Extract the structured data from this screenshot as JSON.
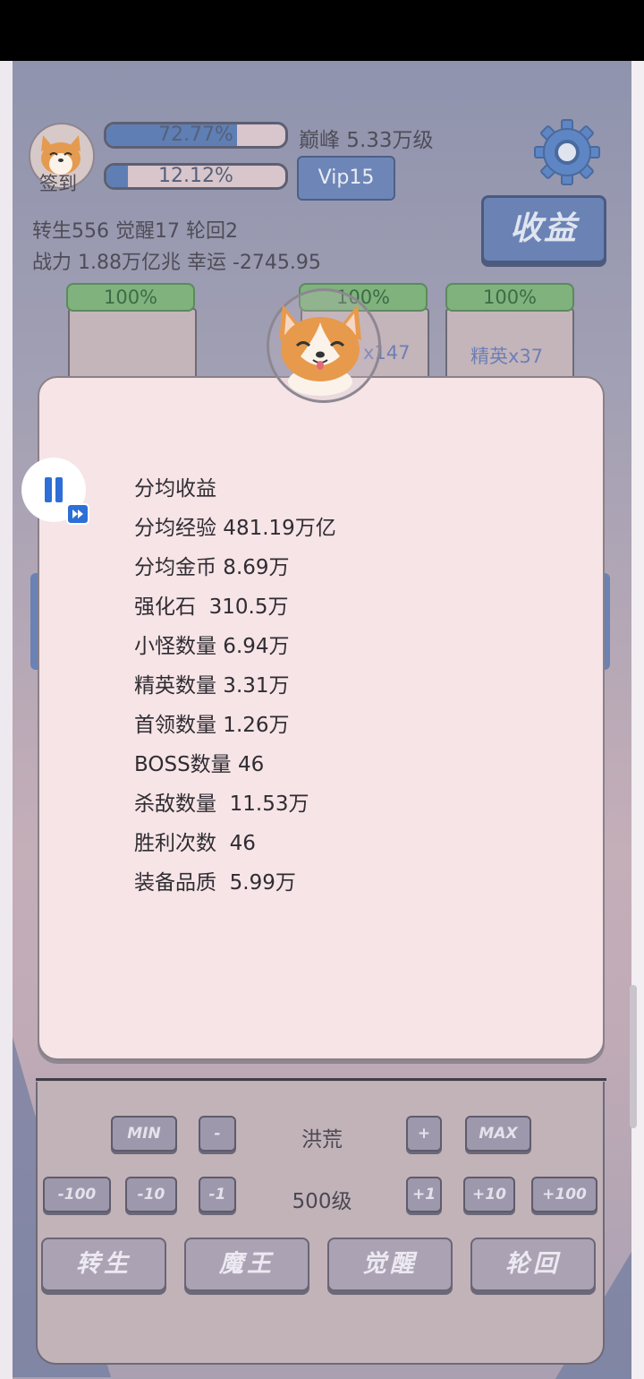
{
  "header": {
    "checkin_label": "签到",
    "bar1_text": "72.77%",
    "bar1_fill": 0.7277,
    "bar2_text": "12.12%",
    "bar2_fill": 0.1212,
    "peak_text": "巅峰 5.33万级",
    "vip_label": "Vip15",
    "income_label": "收益",
    "stat_line1": "转生556 觉醒17 轮回2",
    "stat_line2": "战力 1.88万亿兆  幸运 -2745.95"
  },
  "cards": [
    {
      "pct": "100%",
      "label": ""
    },
    {
      "pct": "100%",
      "label": "x147"
    },
    {
      "pct": "100%",
      "label": "精英x37"
    }
  ],
  "modal": {
    "items": [
      "分均收益",
      "分均经验 481.19万亿",
      "分均金币 8.69万",
      "强化石  310.5万",
      "小怪数量 6.94万",
      "精英数量 3.31万",
      "首领数量 1.26万",
      "BOSS数量 46",
      "杀敌数量  11.53万",
      "胜利次数  46",
      "装备品质  5.99万"
    ]
  },
  "controls": {
    "row1": {
      "min": "MIN",
      "minus": "-",
      "center": "洪荒",
      "plus": "+",
      "max": "MAX"
    },
    "row2": {
      "m100": "-100",
      "m10": "-10",
      "m1": "-1",
      "center": "500级",
      "p1": "+1",
      "p10": "+10",
      "p100": "+100"
    },
    "actions": [
      "转生",
      "魔王",
      "觉醒",
      "轮回"
    ]
  },
  "colors": {
    "accent": "#6a82b4",
    "modal_bg": "#f6e4e6",
    "green": "#7fb27c",
    "float_blue": "#2d6fd6"
  }
}
